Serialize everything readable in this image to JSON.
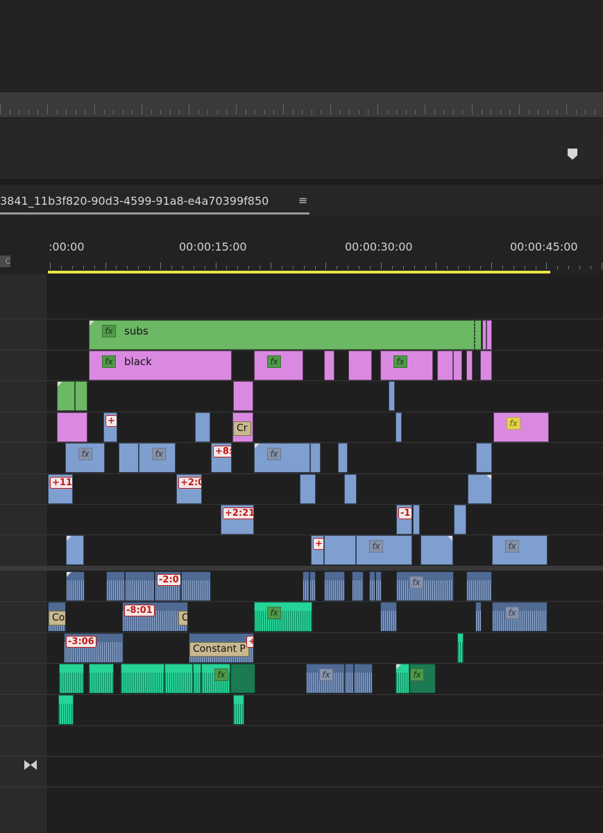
{
  "sequence": {
    "tab_title": "3841_11b3f820-90d3-4599-91a8-e4a70399f850",
    "menu_icon": "hamburger-menu-icon"
  },
  "ruler": {
    "timecodes": [
      ":00:00",
      "00:00:15:00",
      "00:00:30:00",
      "00:00:45:00"
    ],
    "timecode_icon_label": "C"
  },
  "clips": {
    "v_subs_label": "subs",
    "v_black_label": "black",
    "fx_label": "fx",
    "speed_labels": [
      "+",
      "+8:",
      "+11",
      "+2:0",
      "+2:21",
      "-1",
      "+",
      "-2:0",
      "-8:01",
      "-3:06",
      "+"
    ],
    "tan_labels": [
      "Cr",
      "Co",
      "C",
      "Constant P"
    ]
  },
  "colors": {
    "video_green": "#6cb864",
    "video_pink": "#d98ae0",
    "video_blue": "#7f9fd0",
    "audio_blue": "#4f6a93",
    "audio_green": "#27d396",
    "work_area": "#e8e548"
  },
  "icons": {
    "playhead_marker": "marker-icon",
    "transition": "bowtie-icon"
  }
}
